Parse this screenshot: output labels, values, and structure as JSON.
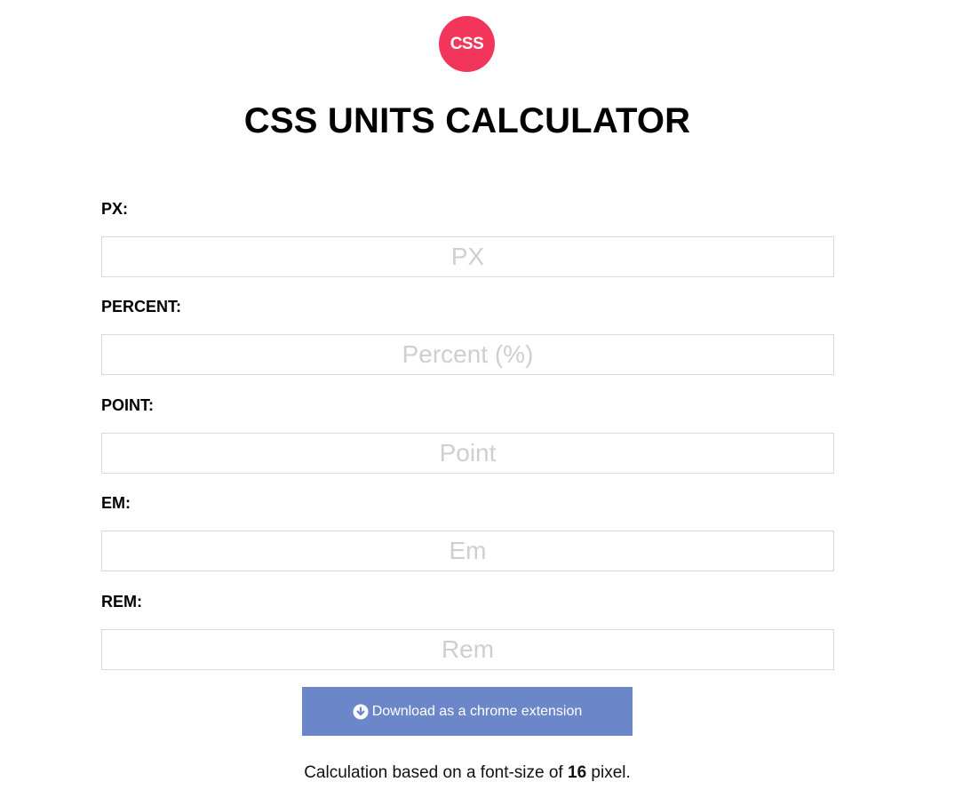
{
  "logo": {
    "text": "CSS",
    "color": "#f2355b"
  },
  "title": "CSS UNITS CALCULATOR",
  "fields": [
    {
      "label": "PX:",
      "placeholder": "PX",
      "value": ""
    },
    {
      "label": "PERCENT:",
      "placeholder": "Percent (%)",
      "value": ""
    },
    {
      "label": "POINT:",
      "placeholder": "Point",
      "value": ""
    },
    {
      "label": "EM:",
      "placeholder": "Em",
      "value": ""
    },
    {
      "label": "REM:",
      "placeholder": "Rem",
      "value": ""
    }
  ],
  "download": {
    "label": "Download as a chrome extension",
    "icon": "download-circle-icon",
    "color": "#6b86c9"
  },
  "footer": {
    "prefix": "Calculation based on a font-size of ",
    "font_size": "16",
    "suffix": " pixel."
  }
}
